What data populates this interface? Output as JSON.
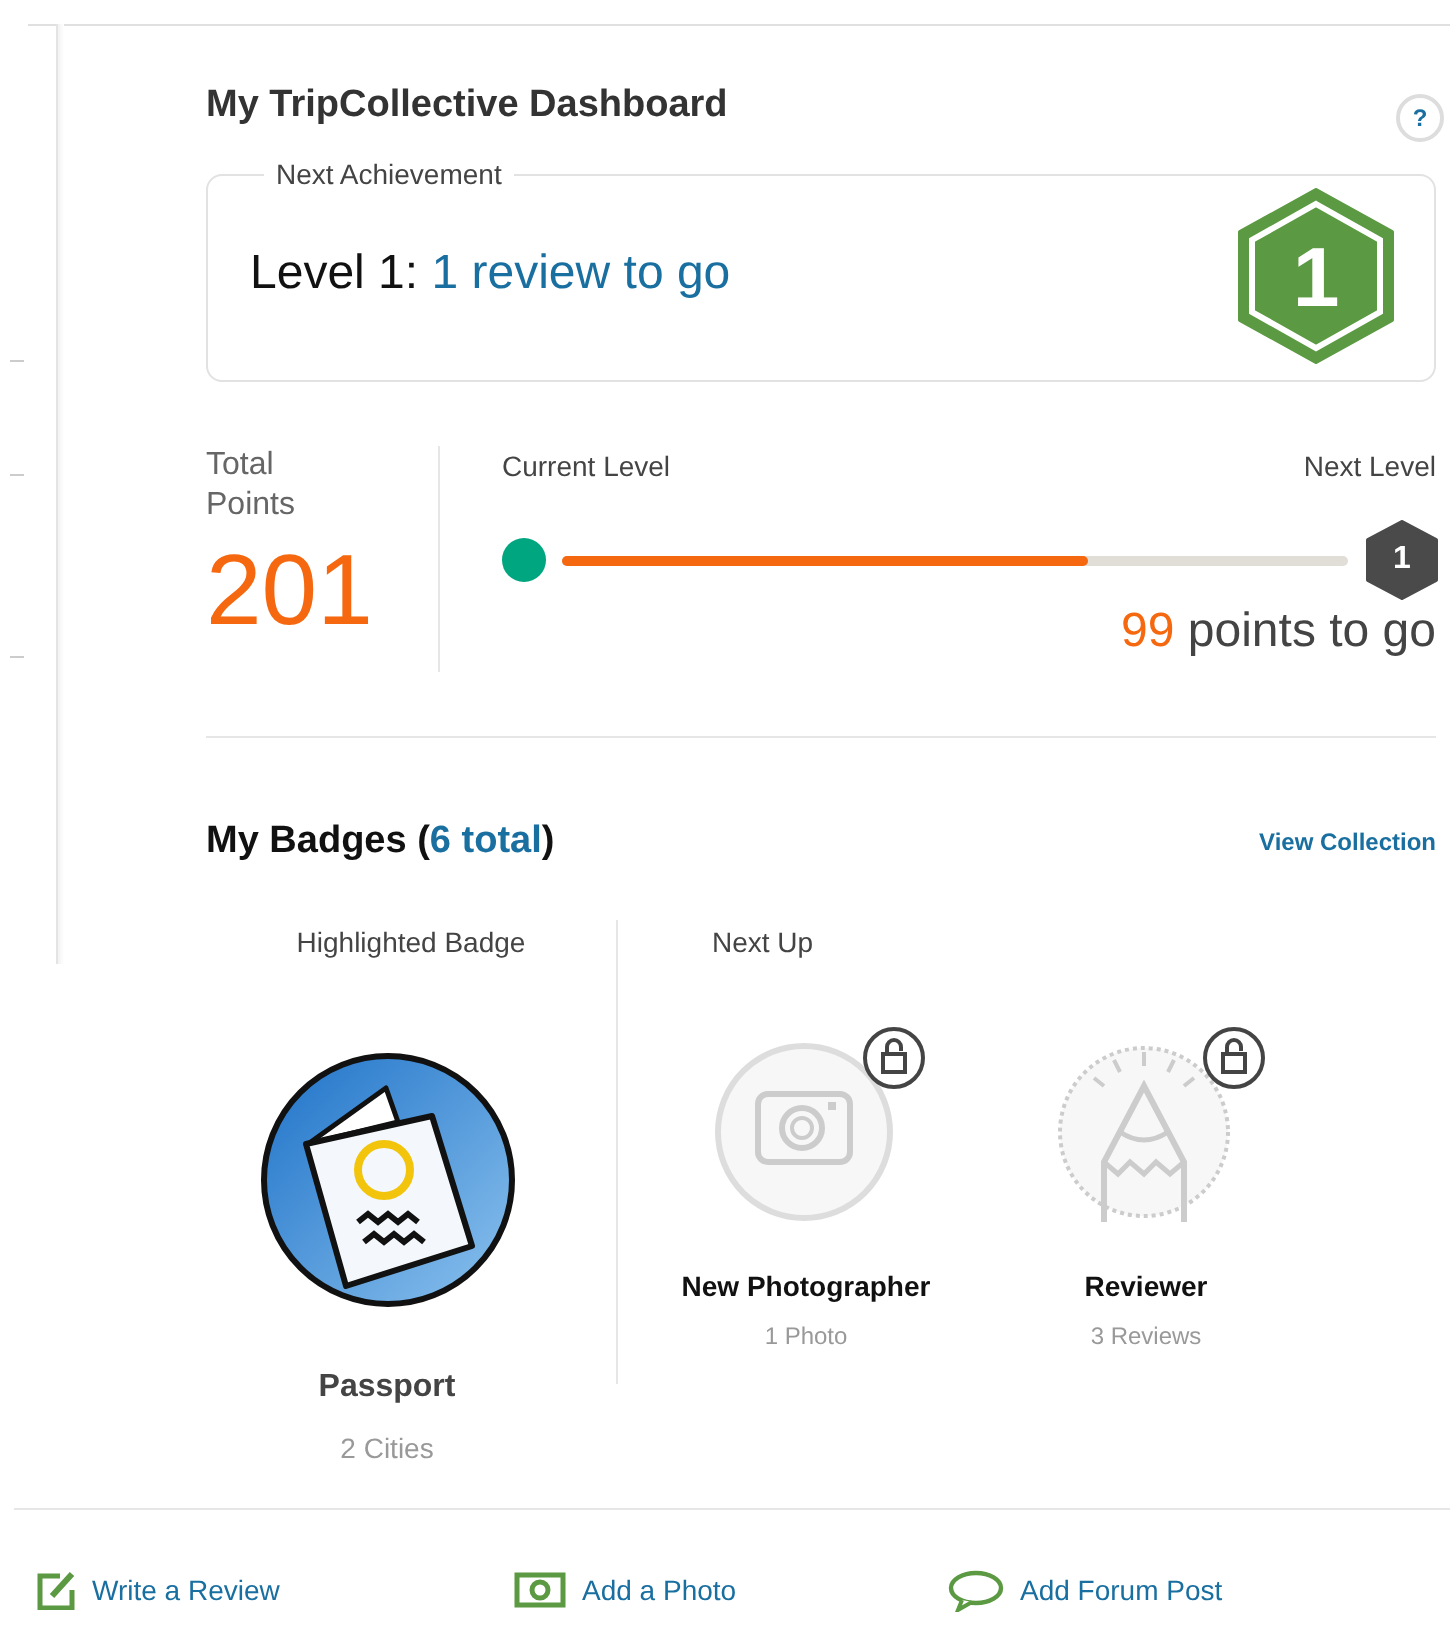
{
  "title": "My TripCollective Dashboard",
  "help_button": "?",
  "achievement": {
    "legend": "Next Achievement",
    "level_label": "Level 1:",
    "progress_text": "1 review to go",
    "badge_number": "1"
  },
  "points": {
    "label": "Total Points",
    "value": "201"
  },
  "progress": {
    "current_label": "Current Level",
    "next_label": "Next Level",
    "level": 0.67,
    "next_badge": "1",
    "remaining": "99",
    "remaining_suffix": "points to go"
  },
  "badges": {
    "title_open": "My Badges (",
    "count": "6 total",
    "title_close": ")",
    "view_link": "View Collection",
    "highlighted": {
      "heading": "Highlighted Badge",
      "name": "Passport",
      "detail": "2 Cities"
    },
    "next_up": {
      "heading": "Next Up",
      "items": [
        {
          "kind": "camera",
          "name": "New Photographer",
          "detail": "1 Photo",
          "locked": true
        },
        {
          "kind": "pencil",
          "name": "Reviewer",
          "detail": "3 Reviews",
          "locked": true
        }
      ]
    }
  },
  "actions": [
    {
      "kind": "pencil",
      "label": "Write a Review"
    },
    {
      "kind": "camera",
      "label": "Add a Photo"
    },
    {
      "kind": "speech",
      "label": "Add Forum Post"
    }
  ]
}
